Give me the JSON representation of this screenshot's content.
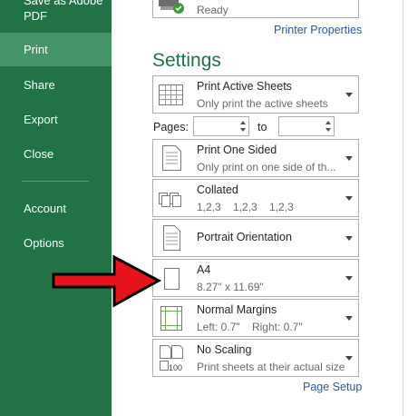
{
  "sidebar": {
    "items": [
      {
        "label": "Save as Adobe"
      },
      {
        "label": "PDF"
      },
      {
        "label": "Print"
      },
      {
        "label": "Share"
      },
      {
        "label": "Export"
      },
      {
        "label": "Close"
      },
      {
        "label": "Account"
      },
      {
        "label": "Options"
      }
    ]
  },
  "printer": {
    "status": "Ready",
    "properties_link": "Printer Properties"
  },
  "settings": {
    "heading": "Settings",
    "active_sheets": {
      "title": "Print Active Sheets",
      "subtitle": "Only print the active sheets"
    },
    "pages": {
      "label": "Pages:",
      "to_label": "to",
      "from_value": "",
      "to_value": ""
    },
    "sides": {
      "title": "Print One Sided",
      "subtitle": "Only print on one side of th..."
    },
    "collation": {
      "title": "Collated",
      "subtitle": "1,2,3    1,2,3    1,2,3"
    },
    "orientation": {
      "title": "Portrait Orientation"
    },
    "paper": {
      "title": "A4",
      "subtitle": "8.27\" x 11.69\""
    },
    "margins": {
      "title": "Normal Margins",
      "subtitle": "Left: 0.7\"    Right: 0.7\""
    },
    "scaling": {
      "title": "No Scaling",
      "subtitle": "Print sheets at their actual size",
      "icon_text": "100"
    },
    "page_setup_link": "Page Setup"
  },
  "colors": {
    "sidebar": "#217346",
    "selected": "#439467",
    "arrow": "#e8141c",
    "link": "#2b579a"
  }
}
